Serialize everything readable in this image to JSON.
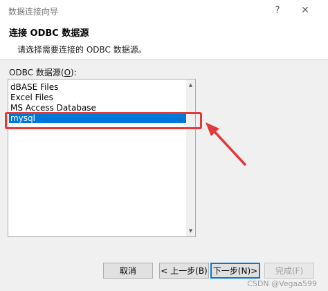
{
  "window": {
    "title": "数据连接向导",
    "controls": {
      "help": "?",
      "close": "✕"
    }
  },
  "header": {
    "title": "连接 ODBC 数据源",
    "subtitle": "请选择需要连接的 ODBC 数据源。"
  },
  "datasource_list": {
    "label_prefix": "ODBC 数据源(",
    "label_accesskey": "O",
    "label_suffix": "):",
    "items": [
      "dBASE Files",
      "Excel Files",
      "MS Access Database",
      "mysql"
    ],
    "selected": "mysql"
  },
  "annotation": {
    "color": "#e03a3a"
  },
  "buttons": {
    "cancel": "取消",
    "back": "< 上一步(B)",
    "next": "下一步(N)>",
    "finish": "完成(F)"
  },
  "watermark": "CSDN @Vegaa599",
  "colors": {
    "selection": "#0078d7",
    "dialog_bg": "#f0f0f0"
  }
}
